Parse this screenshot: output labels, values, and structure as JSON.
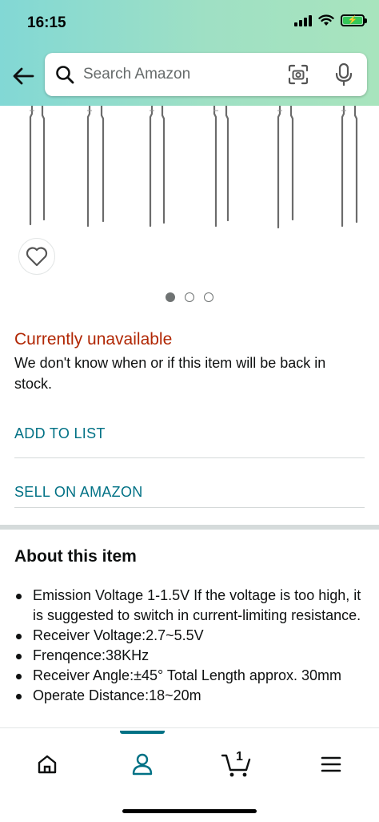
{
  "status_bar": {
    "time": "16:15"
  },
  "search": {
    "placeholder": "Search Amazon"
  },
  "availability": {
    "status": "Currently unavailable",
    "message": "We don't know when or if this item will be back in stock."
  },
  "actions": {
    "add_to_list": "ADD TO LIST",
    "sell_on_amazon": "SELL ON AMAZON"
  },
  "about": {
    "title": "About this item",
    "bullets": [
      "Emission Voltage 1-1.5V If the voltage is too high, it is suggested to switch in current-limiting resistance.",
      "Receiver Voltage:2.7~5.5V",
      "Frenqence:38KHz",
      "Receiver Angle:±45° Total Length approx. 30mm",
      "Operate Distance:18~20m"
    ]
  },
  "image_carousel": {
    "total": 3,
    "active": 1
  },
  "bottom_nav": {
    "items": [
      "home-icon",
      "account-icon",
      "cart-icon",
      "menu-icon"
    ],
    "active": "account-icon",
    "cart_count": "1"
  },
  "colors": {
    "header_gradient_start": "#82d8d5",
    "header_gradient_end": "#a8e4bd",
    "unavailable": "#b12704",
    "link": "#007185"
  }
}
